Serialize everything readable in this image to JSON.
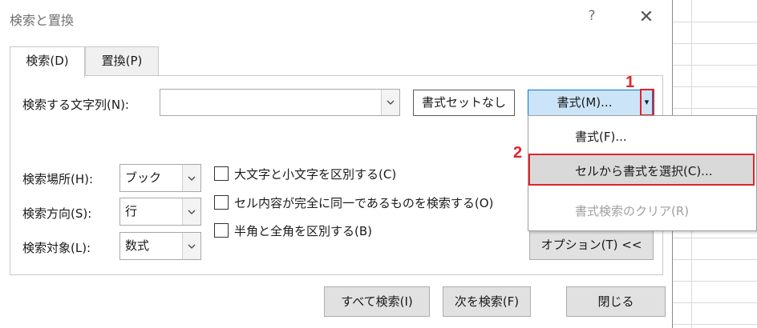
{
  "dialog": {
    "title": "検索と置換",
    "help_label": "?",
    "close_label": "✕"
  },
  "tabs": [
    {
      "label": "検索(D)",
      "active": true
    },
    {
      "label": "置換(P)",
      "active": false
    }
  ],
  "search": {
    "label": "検索する文字列(N):",
    "value": "",
    "format_status": "書式セットなし",
    "format_button": "書式(M)...",
    "format_arrow": "▾"
  },
  "options": {
    "within": {
      "label": "検索場所(H):",
      "value": "ブック"
    },
    "search_order": {
      "label": "検索方向(S):",
      "value": "行"
    },
    "look_in": {
      "label": "検索対象(L):",
      "value": "数式"
    },
    "checkboxes": [
      {
        "label": "大文字と小文字を区別する(C)",
        "checked": false
      },
      {
        "label": "セル内容が完全に同一であるものを検索する(O)",
        "checked": false
      },
      {
        "label": "半角と全角を区別する(B)",
        "checked": false
      }
    ],
    "options_button": "オプション(T) <<"
  },
  "footer": {
    "find_all": "すべて検索(I)",
    "find_next": "次を検索(F)",
    "close": "閉じる"
  },
  "format_menu": {
    "items": [
      {
        "label": "書式(F)...",
        "state": "normal"
      },
      {
        "label": "セルから書式を選択(C)...",
        "state": "hover"
      },
      {
        "label": "書式検索のクリア(R)",
        "state": "disabled"
      }
    ]
  },
  "annotations": {
    "marker1": "1",
    "marker2": "2",
    "color": "#e0242b"
  }
}
